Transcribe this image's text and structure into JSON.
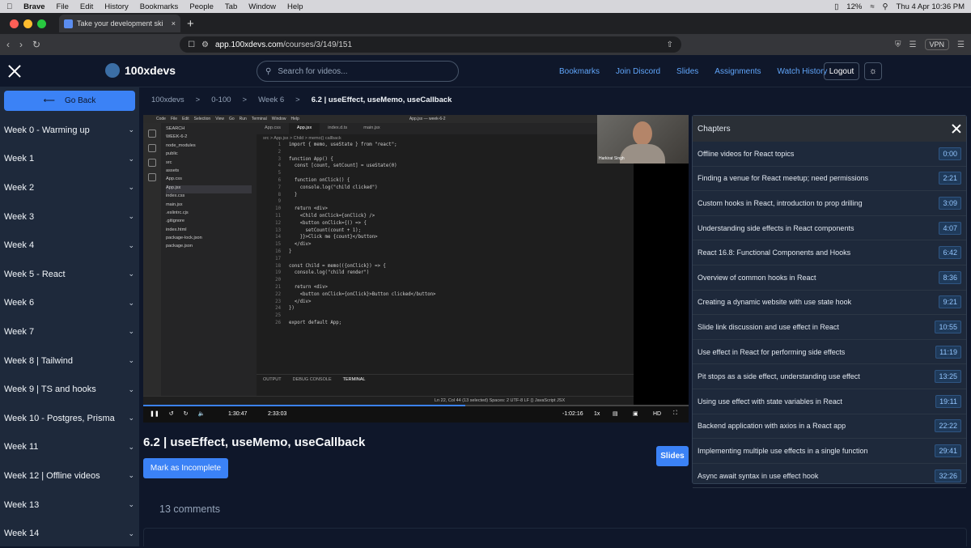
{
  "mac_menu": {
    "app": "Brave",
    "items": [
      "File",
      "Edit",
      "History",
      "Bookmarks",
      "People",
      "Tab",
      "Window",
      "Help"
    ],
    "battery": "12%",
    "datetime": "Thu 4 Apr  10:36 PM"
  },
  "browser": {
    "tab_title": "Take your development ski",
    "url_host": "app.100xdevs.com",
    "url_path": "/courses/3/149/151",
    "vpn_label": "VPN"
  },
  "header": {
    "brand": "100xdevs",
    "search_placeholder": "Search for videos...",
    "links": [
      "Bookmarks",
      "Join Discord",
      "Slides",
      "Assignments",
      "Watch History"
    ],
    "logout": "Logout"
  },
  "sidebar": {
    "go_back": "Go Back",
    "weeks": [
      "Week 0 - Warming up",
      "Week 1",
      "Week 2",
      "Week 3",
      "Week 4",
      "Week 5 - React",
      "Week 6",
      "Week 7",
      "Week 8 | Tailwind",
      "Week 9 | TS and hooks",
      "Week 10 - Postgres, Prisma",
      "Week 11",
      "Week 12 | Offline videos",
      "Week 13",
      "Week 14"
    ]
  },
  "breadcrumb": {
    "items": [
      "100xdevs",
      "0-100",
      "Week 6",
      "6.2 | useEffect, useMemo, useCallback"
    ],
    "sep": ">"
  },
  "video": {
    "vscode_title": "App.jsx — week-6-2",
    "explorer_items": [
      "SEARCH",
      "WEEK-6-2",
      "node_modules",
      "public",
      "src",
      "assets",
      "App.css",
      "App.jsx",
      "index.css",
      "main.jsx",
      ".eslintrc.cjs",
      ".gitignore",
      "index.html",
      "package-lock.json",
      "package.json"
    ],
    "tabs": [
      "App.css",
      "App.jsx",
      "index.d.ts",
      "main.jsx"
    ],
    "crumb": "src > App.jsx > Child > memo() callback",
    "code": [
      [
        "1",
        "import { memo, useState } from \"react\";"
      ],
      [
        "2",
        ""
      ],
      [
        "3",
        "function App() {"
      ],
      [
        "4",
        "  const [count, setCount] = useState(0)"
      ],
      [
        "5",
        ""
      ],
      [
        "6",
        "  function onClick() {"
      ],
      [
        "7",
        "    console.log(\"child clicked\")"
      ],
      [
        "8",
        "  }"
      ],
      [
        "9",
        ""
      ],
      [
        "10",
        "  return <div>"
      ],
      [
        "11",
        "    <Child onClick={onClick} />"
      ],
      [
        "12",
        "    <button onClick={() => {"
      ],
      [
        "13",
        "      setCount(count + 1);"
      ],
      [
        "14",
        "    }}>Click me {count}</button>"
      ],
      [
        "15",
        "  </div>"
      ],
      [
        "16",
        "}"
      ],
      [
        "17",
        ""
      ],
      [
        "18",
        "const Child = memo(({onClick}) => {"
      ],
      [
        "19",
        "  console.log(\"child render\")"
      ],
      [
        "20",
        ""
      ],
      [
        "21",
        "  return <div>"
      ],
      [
        "22",
        "    <button onClick={onClick}>Button clicked</button>"
      ],
      [
        "23",
        "  </div>"
      ],
      [
        "24",
        "})"
      ],
      [
        "25",
        ""
      ],
      [
        "26",
        "export default App;"
      ]
    ],
    "terminal_tabs": [
      "OUTPUT",
      "DEBUG CONSOLE",
      "TERMINAL"
    ],
    "status": "Ln 22, Col 44 (13 selected)   Spaces: 2   UTF-8   LF   {} JavaScript JSX",
    "cam_name": "Harkirat Singh",
    "time_current": "1:30:47",
    "time_duration": "2:33:03",
    "time_remaining": "-1:02:16",
    "speed": "1x",
    "progress": 0.59
  },
  "main": {
    "title": "6.2 | useEffect, useMemo, useCallback",
    "mark_button": "Mark as Incomplete",
    "slides_button": "Slides",
    "comments": "13 comments"
  },
  "chapters": {
    "title": "Chapters",
    "items": [
      {
        "label": "Offline videos for React topics",
        "time": "0:00"
      },
      {
        "label": "Finding a venue for React meetup; need permissions",
        "time": "2:21"
      },
      {
        "label": "Custom hooks in React, introduction to prop drilling",
        "time": "3:09"
      },
      {
        "label": "Understanding side effects in React components",
        "time": "4:07"
      },
      {
        "label": "React 16.8: Functional Components and Hooks",
        "time": "6:42"
      },
      {
        "label": "Overview of common hooks in React",
        "time": "8:36"
      },
      {
        "label": "Creating a dynamic website with use state hook",
        "time": "9:21"
      },
      {
        "label": "Slide link discussion and use effect in React",
        "time": "10:55"
      },
      {
        "label": "Use effect in React for performing side effects",
        "time": "11:19"
      },
      {
        "label": "Pit stops as a side effect, understanding use effect",
        "time": "13:25"
      },
      {
        "label": "Using use effect with state variables in React",
        "time": "19:11"
      },
      {
        "label": "Backend application with axios in a React app",
        "time": "22:22"
      },
      {
        "label": "Implementing multiple use effects in a single function",
        "time": "29:41"
      },
      {
        "label": "Async await syntax in use effect hook",
        "time": "32:26"
      }
    ]
  }
}
